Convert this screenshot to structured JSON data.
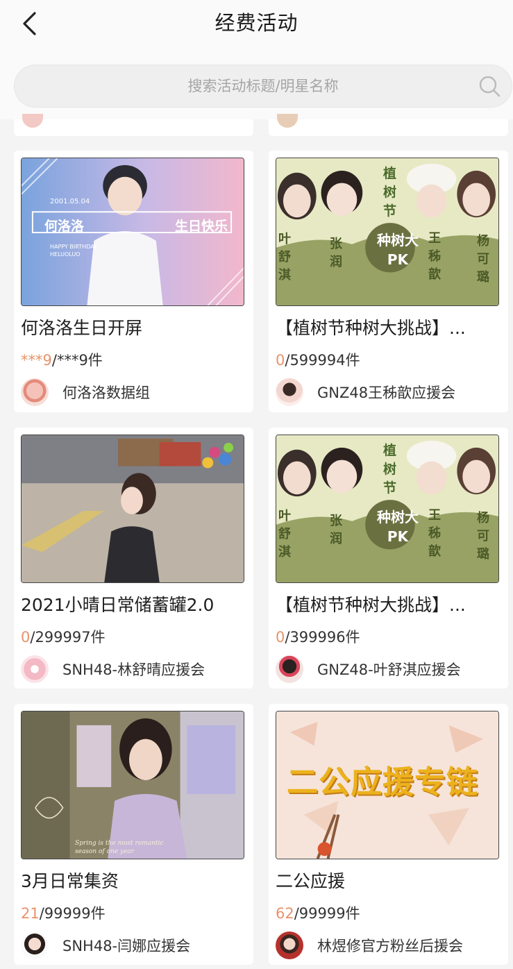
{
  "header": {
    "title": "经费活动",
    "back_icon": "back-arrow-icon"
  },
  "search": {
    "placeholder": "搜索活动标题/明星名称",
    "icon": "search-icon"
  },
  "cards": [
    {
      "title": "何洛洛生日开屏",
      "count_current": "***9",
      "count_rest": "/***9件",
      "org": "何洛洛数据组",
      "banner": {
        "date": "2001.05.04",
        "name": "何洛洛",
        "greeting": "生日快乐",
        "sub1": "HAPPY BIRTHDAY",
        "sub2": "HELUOLUO"
      }
    },
    {
      "title": "【植树节种树大挑战】...",
      "count_current": "0",
      "count_rest": "/599994件",
      "org": "GNZ48王秭歆应援会",
      "banner": {
        "badge": "种树大PK",
        "n1": "叶舒淇",
        "n2": "张润",
        "n3": "王秭歆",
        "n4": "杨可璐",
        "top": "植树节"
      }
    },
    {
      "title": "2021小晴日常储蓄罐2.0",
      "count_current": "0",
      "count_rest": "/299997件",
      "org": "SNH48-林舒晴应援会"
    },
    {
      "title": "【植树节种树大挑战】...",
      "count_current": "0",
      "count_rest": "/399996件",
      "org": "GNZ48-叶舒淇应援会",
      "banner": {
        "badge": "种树大PK",
        "n1": "叶舒淇",
        "n2": "张润",
        "n3": "王秭歆",
        "n4": "杨可璐",
        "top": "植树节"
      }
    },
    {
      "title": "3月日常集资",
      "count_current": "21",
      "count_rest": "/99999件",
      "org": "SNH48-闫娜应援会",
      "banner": {
        "script1": "Spring is the most romantic",
        "script2": "season of one year"
      }
    },
    {
      "title": "二公应援",
      "count_current": "62",
      "count_rest": "/99999件",
      "org": "林煜修官方粉丝后援会",
      "banner": {
        "headline": "二公应援专链"
      }
    }
  ],
  "colors": {
    "accent_count": "#e8936a",
    "background": "#f4f4f4",
    "card": "#ffffff"
  }
}
